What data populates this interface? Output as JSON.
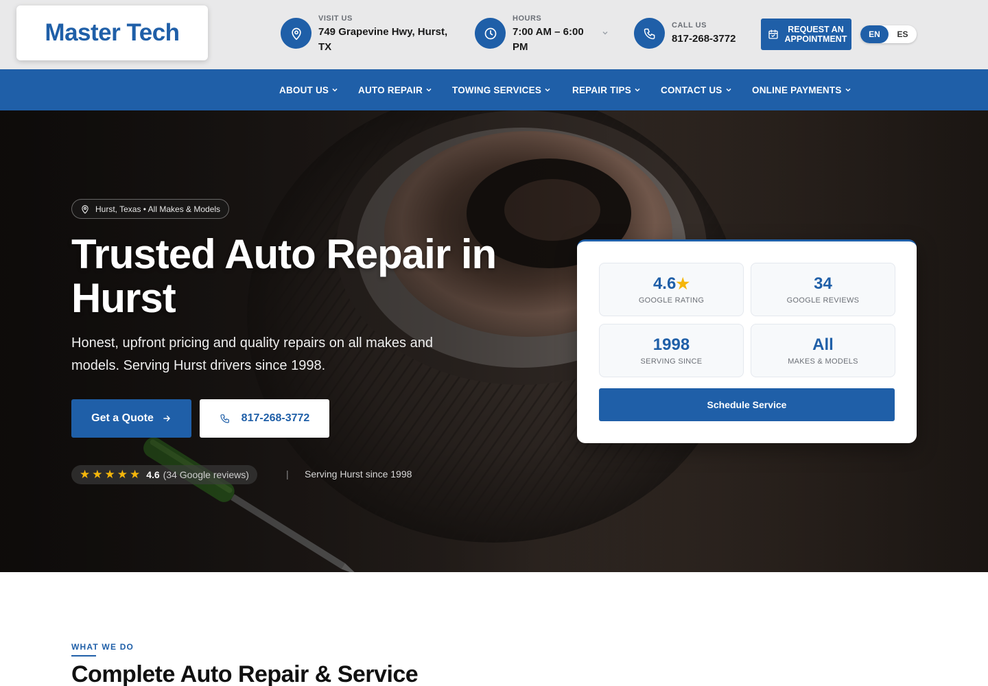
{
  "header": {
    "logo": "Master Tech",
    "visit": {
      "label": "VISIT US",
      "value": "749 Grapevine Hwy, Hurst, TX",
      "icon": "map-pin-icon"
    },
    "hours": {
      "label": "HOURS",
      "value": "7:00 AM – 6:00 PM",
      "icon": "clock-icon"
    },
    "call": {
      "label": "CALL US",
      "value": "817-268-3772",
      "icon": "phone-icon"
    },
    "appointment_button": "REQUEST AN APPOINTMENT",
    "languages": [
      "EN",
      "ES"
    ],
    "active_language": "EN"
  },
  "nav": {
    "items": [
      {
        "label": "ABOUT US"
      },
      {
        "label": "AUTO REPAIR"
      },
      {
        "label": "TOWING SERVICES"
      },
      {
        "label": "REPAIR TIPS"
      },
      {
        "label": "CONTACT US"
      },
      {
        "label": "ONLINE PAYMENTS"
      }
    ]
  },
  "hero": {
    "location_pill": "Hurst, Texas • All Makes & Models",
    "title": "Trusted Auto Repair in Hurst",
    "subtitle": "Honest, upfront pricing and quality repairs on all makes and models. Serving Hurst drivers since 1998.",
    "quote_button": "Get a Quote",
    "phone_button": "817-268-3772",
    "rating": {
      "stars": "★★★★★",
      "value": "4.6",
      "reviews": "(34 Google reviews)"
    },
    "separator": "|",
    "since_text": "Serving Hurst since 1998"
  },
  "stats_card": {
    "stats": [
      {
        "value": "4.6",
        "suffix": "★",
        "label": "GOOGLE RATING"
      },
      {
        "value": "34",
        "suffix": "",
        "label": "GOOGLE REVIEWS"
      },
      {
        "value": "1998",
        "suffix": "",
        "label": "SERVING SINCE"
      },
      {
        "value": "All",
        "suffix": "",
        "label": "MAKES & MODELS"
      }
    ],
    "schedule_button": "Schedule Service"
  },
  "services": {
    "eyebrow": "WHAT WE DO",
    "title": "Complete Auto Repair & Service"
  },
  "colors": {
    "brand_blue": "#1f5fa8",
    "star_gold": "#f5b60b",
    "header_bg": "#e9e9ea"
  }
}
